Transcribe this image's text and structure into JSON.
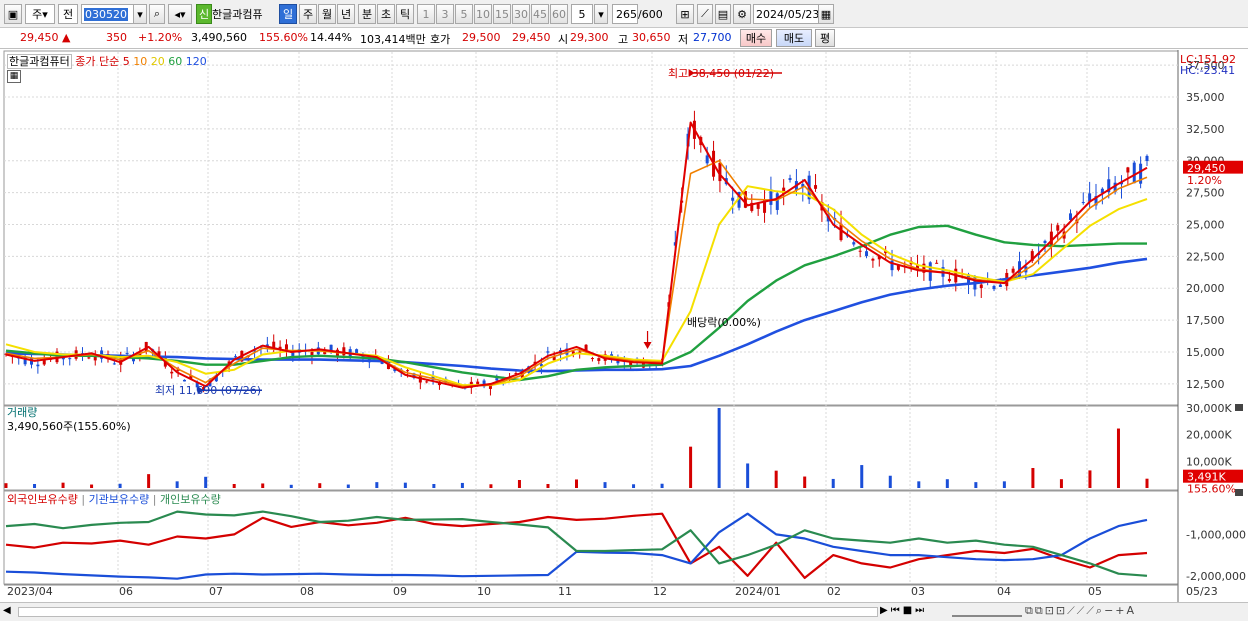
{
  "toolbar": {
    "market": "주",
    "period": "전",
    "code": "030520",
    "name": "한글과컴퓨",
    "new_badge": "신",
    "tabs": [
      "일",
      "주",
      "월",
      "년",
      "분",
      "초",
      "틱"
    ],
    "active_tab": "일",
    "nums": [
      "1",
      "3",
      "5",
      "10",
      "15",
      "30",
      "45",
      "60"
    ],
    "n_value": "5",
    "count": "265",
    "count_total": "/600",
    "date": "2024/05/23"
  },
  "quote": {
    "price": "29,450",
    "change": "350",
    "change_pct": "+1.20%",
    "volume": "3,490,560",
    "vol_ratio": "155.60%",
    "turnover": "14.44%",
    "amount": "103,414백만",
    "ask_label": "호가",
    "ask1": "29,500",
    "ask2": "29,450",
    "open_label": "시",
    "open": "29,300",
    "high_label": "고",
    "high": "30,650",
    "low_label": "저",
    "low": "27,700",
    "buy": "매수",
    "sell": "매도",
    "avg": "평"
  },
  "price_panel": {
    "legend_name": "한글과컴퓨터",
    "legend_ma": "종가 단순 5",
    "ma": [
      "10",
      "20",
      "60",
      "120"
    ],
    "lc": "LC:151.92",
    "hc": "HC:-23.41",
    "ticks": [
      "37,500",
      "35,000",
      "32,500",
      "30,000",
      "27,500",
      "25,000",
      "22,500",
      "20,000",
      "17,500",
      "15,000",
      "12,500"
    ],
    "current_price": "29,450",
    "current_pct": "1.20%",
    "high_ann": "최고 38,450 (01/22)",
    "low_ann": "최저 11,690 (07/26)",
    "div_ann": "배당락(0.00%)"
  },
  "volume_panel": {
    "title": "거래량",
    "value": "3,490,560주(155.60%)",
    "ticks": [
      "30,000K",
      "20,000K",
      "10,000K"
    ],
    "current": "3,491K",
    "current_pct": "155.60%"
  },
  "holding_panel": {
    "legend": [
      "외국인보유수량",
      "기관보유수량",
      "개인보유수량"
    ],
    "ticks": [
      "-1,000,000",
      "-2,000,000"
    ]
  },
  "x_axis": {
    "labels": [
      "2023/04",
      "06",
      "07",
      "08",
      "09",
      "10",
      "11",
      "12",
      "2024/01",
      "02",
      "03",
      "04",
      "05",
      "05/23"
    ]
  },
  "colors": {
    "up": "#d40000",
    "down": "#1a4ed8",
    "ma5": "#e00000",
    "ma10": "#f08000",
    "ma20": "#f5e000",
    "ma60": "#20a040",
    "ma120": "#2050e0"
  },
  "chart_data": [
    {
      "type": "line",
      "title": "",
      "ylim": [
        11000,
        38450
      ],
      "series": [
        {
          "name": "5",
          "values": [
            14800,
            14300,
            14600,
            14900,
            14200,
            15400,
            13400,
            12300,
            14400,
            15500,
            15000,
            15200,
            14900,
            14600,
            13200,
            12700,
            12200,
            12500,
            13300,
            14700,
            15400,
            14500,
            14200,
            14100,
            33000,
            29000,
            26500,
            27000,
            28500,
            25000,
            23400,
            22000,
            21400,
            21200,
            20600,
            20400,
            22300,
            24500,
            26800,
            28200,
            29450
          ]
        },
        {
          "name": "10",
          "values": [
            14900,
            14500,
            14600,
            14800,
            14400,
            15100,
            13700,
            12600,
            14100,
            15300,
            15100,
            15100,
            14900,
            14600,
            13400,
            12900,
            12300,
            12400,
            13100,
            14500,
            15200,
            14600,
            14300,
            14200,
            29000,
            30000,
            27000,
            26900,
            28000,
            25500,
            23700,
            22300,
            21500,
            21200,
            20700,
            20400,
            21800,
            24000,
            26300,
            27800,
            28700
          ]
        },
        {
          "name": "20",
          "values": [
            15600,
            15000,
            14800,
            14800,
            14600,
            14700,
            14200,
            13300,
            13600,
            14800,
            15100,
            15100,
            14900,
            14700,
            13800,
            13100,
            12400,
            12400,
            12800,
            14100,
            14900,
            14700,
            14400,
            14300,
            18200,
            25000,
            28000,
            27600,
            27400,
            26200,
            24200,
            22700,
            21800,
            21400,
            20900,
            20500,
            21100,
            23000,
            24900,
            26200,
            27000
          ]
        },
        {
          "name": "60",
          "values": [
            15100,
            14900,
            14700,
            14700,
            14600,
            14500,
            14300,
            14000,
            14000,
            14300,
            14600,
            14700,
            14600,
            14500,
            14200,
            13800,
            13400,
            13100,
            12800,
            13100,
            13600,
            13800,
            13900,
            14000,
            15000,
            16900,
            19000,
            20600,
            21800,
            22500,
            23300,
            24200,
            24800,
            24900,
            24200,
            23600,
            23400,
            23300,
            23400,
            23500,
            23500
          ]
        },
        {
          "name": "120",
          "values": [
            14900,
            14850,
            14800,
            14750,
            14700,
            14650,
            14600,
            14500,
            14450,
            14400,
            14400,
            14400,
            14350,
            14300,
            14200,
            14050,
            13900,
            13700,
            13550,
            13500,
            13550,
            13600,
            13600,
            13650,
            13900,
            14700,
            15600,
            16600,
            17500,
            18200,
            18900,
            19500,
            19900,
            20200,
            20400,
            20700,
            21000,
            21300,
            21600,
            22000,
            22300
          ]
        }
      ],
      "annotations": [
        "최고 38,450 (01/22)",
        "최저 11,690 (07/26)",
        "배당락(0.00%)"
      ]
    },
    {
      "type": "bar",
      "title": "",
      "ylim": [
        0,
        30000
      ],
      "unit": "K",
      "values": [
        1800,
        1500,
        2000,
        1300,
        1600,
        5200,
        2500,
        4200,
        1500,
        1700,
        1200,
        1800,
        1300,
        2200,
        2000,
        1500,
        1900,
        1400,
        3000,
        1500,
        3200,
        2200,
        1400,
        1600,
        15500,
        30000,
        9200,
        6500,
        4300,
        3400,
        8600,
        4600,
        2500,
        3300,
        2200,
        2500,
        7500,
        3300,
        6600,
        22300,
        3491
      ]
    },
    {
      "type": "line",
      "title": "",
      "ylim": [
        -2150000,
        0
      ],
      "series": [
        {
          "name": "외국인보유수량",
          "values": [
            -1250000,
            -1320000,
            -1200000,
            -1220000,
            -1150000,
            -1250000,
            -1050000,
            -1100000,
            -1000000,
            -600000,
            -820000,
            -700000,
            -780000,
            -720000,
            -600000,
            -750000,
            -800000,
            -750000,
            -700000,
            -580000,
            -650000,
            -620000,
            -550000,
            -500000,
            -1700000,
            -1300000,
            -2000000,
            -1200000,
            -2050000,
            -1500000,
            -1700000,
            -1800000,
            -1600000,
            -1500000,
            -1400000,
            -1450000,
            -1350000,
            -1600000,
            -1800000,
            -1500000,
            -1450000
          ]
        },
        {
          "name": "기관보유수량",
          "values": [
            -1900000,
            -1920000,
            -1960000,
            -1990000,
            -2020000,
            -2040000,
            -2070000,
            -1970000,
            -1950000,
            -1970000,
            -1960000,
            -1950000,
            -1970000,
            -1980000,
            -1980000,
            -1990000,
            -2010000,
            -2000000,
            -1990000,
            -1980000,
            -1420000,
            -1440000,
            -1450000,
            -1500000,
            -1700000,
            -950000,
            -500000,
            -1000000,
            -1100000,
            -1300000,
            -1400000,
            -1500000,
            -1500000,
            -1550000,
            -1600000,
            -1620000,
            -1600000,
            -1500000,
            -1100000,
            -800000,
            -650000
          ]
        },
        {
          "name": "개인보유수량",
          "values": [
            -800000,
            -750000,
            -850000,
            -770000,
            -720000,
            -700000,
            -450000,
            -520000,
            -540000,
            -450000,
            -560000,
            -700000,
            -670000,
            -580000,
            -650000,
            -640000,
            -630000,
            -700000,
            -760000,
            -830000,
            -1400000,
            -1400000,
            -1380000,
            -1360000,
            -900000,
            -1700000,
            -1500000,
            -1250000,
            -900000,
            -1100000,
            -1150000,
            -1200000,
            -1100000,
            -1200000,
            -1150000,
            -1250000,
            -1300000,
            -1500000,
            -1700000,
            -1950000,
            -2000000
          ]
        }
      ]
    }
  ]
}
